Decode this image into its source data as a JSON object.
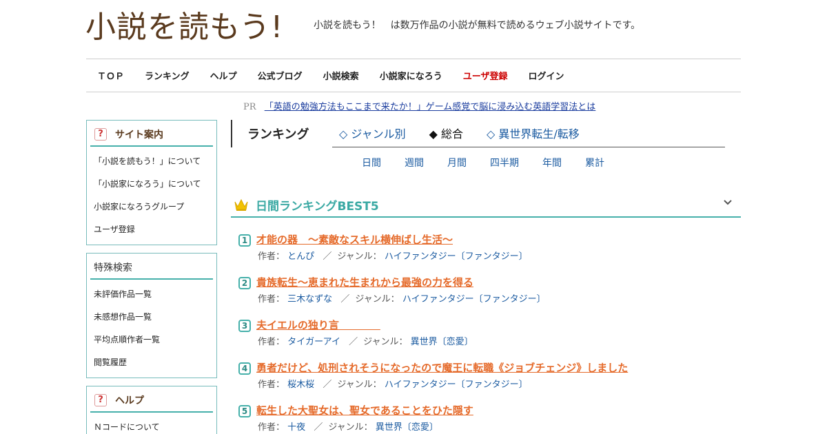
{
  "header": {
    "logo_text": "小説を読もう!",
    "tagline": "小説を読もう！　は数万作品の小説が無料で読めるウェブ小説サイトです。"
  },
  "nav": [
    {
      "label": "ＴＯＰ"
    },
    {
      "label": "ランキング"
    },
    {
      "label": "ヘルプ"
    },
    {
      "label": "公式ブログ"
    },
    {
      "label": "小説検索"
    },
    {
      "label": "小説家になろう"
    },
    {
      "label": "ユーザ登録",
      "color": "#cc0000"
    },
    {
      "label": "ログイン"
    }
  ],
  "pr": {
    "tag": "PR",
    "link": "「英語の勉強方法もここまで来たか！」ゲーム感覚で脳に浸み込む英語学習法とは"
  },
  "sidebar": {
    "site_guide": {
      "title": "サイト案内",
      "items": [
        "「小説を読もう！」について",
        "「小説家になろう」について",
        "小説家になろうグループ",
        "ユーザ登録"
      ]
    },
    "special_search": {
      "title": "特殊検索",
      "items": [
        "未評価作品一覧",
        "未感想作品一覧",
        "平均点順作者一覧",
        "閲覧履歴"
      ]
    },
    "help": {
      "title": "ヘルプ",
      "items": [
        "Ｎコードについて"
      ]
    }
  },
  "ranking": {
    "title": "ランキング",
    "tabs": [
      {
        "label": "◇ ジャンル別",
        "active": false
      },
      {
        "label": "◆ 総合",
        "active": true
      },
      {
        "label": "◇ 異世界転生/転移",
        "active": false
      }
    ],
    "periods": [
      "日間",
      "週間",
      "月間",
      "四半期",
      "年間",
      "累計"
    ],
    "best_title": "日間ランキングBEST5",
    "author_label": "作者：",
    "genre_label": "ジャンル：",
    "separator": "／",
    "items": [
      {
        "rank": "1",
        "title": "才能の器　～素敵なスキル横伸ばし生活～",
        "author": "とんぴ",
        "genre": "ハイファンタジー〔ファンタジー〕"
      },
      {
        "rank": "2",
        "title": "貴族転生～恵まれた生まれから最強の力を得る",
        "author": "三木なずな",
        "genre": "ハイファンタジー〔ファンタジー〕"
      },
      {
        "rank": "3",
        "title": "夫イエルの独り言　　　　",
        "author": "タイガーアイ",
        "genre": "異世界〔恋愛〕"
      },
      {
        "rank": "4",
        "title": "勇者だけど、処刑されそうになったので魔王に転職《ジョブチェンジ》しました",
        "author": "桜木桜",
        "genre": "ハイファンタジー〔ファンタジー〕"
      },
      {
        "rank": "5",
        "title": "転生した大聖女は、聖女であることをひた隠す",
        "author": "十夜",
        "genre": "異世界〔恋愛〕"
      }
    ]
  },
  "colors": {
    "accent": "#45b0aa",
    "title_link": "#e56a2a",
    "link": "#1a5aa0",
    "brand": "#5a3a1e"
  },
  "icons": {
    "crown": "crown-icon",
    "help": "question-icon",
    "chevron": "chevron-down-icon"
  }
}
